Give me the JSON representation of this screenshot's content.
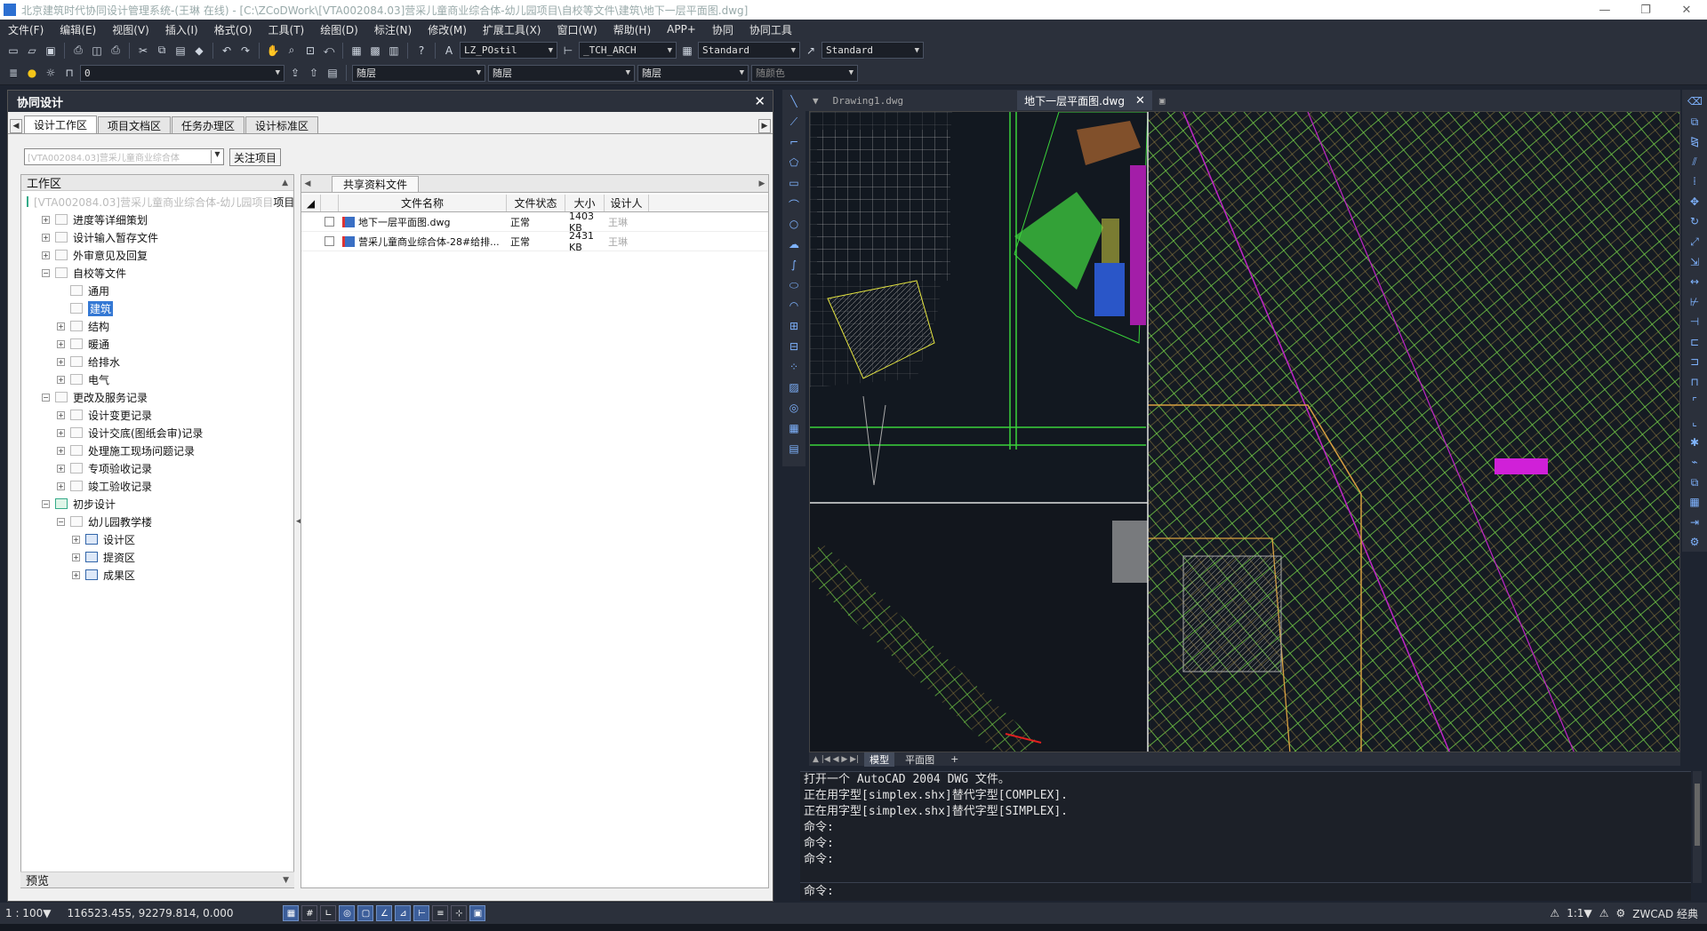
{
  "title_bar": {
    "text": "北京建筑时代协同设计管理系统-(王琳 在线) - [C:\\ZCoDWork\\[VTA002084.03]营采儿童商业综合体-幼儿园项目\\自校等文件\\建筑\\地下一层平面图.dwg]",
    "minimize": "—",
    "maximize": "❐",
    "close": "✕"
  },
  "menu": [
    "文件(F)",
    "编辑(E)",
    "视图(V)",
    "插入(I)",
    "格式(O)",
    "工具(T)",
    "绘图(D)",
    "标注(N)",
    "修改(M)",
    "扩展工具(X)",
    "窗口(W)",
    "帮助(H)",
    "APP+",
    "协同",
    "协同工具"
  ],
  "toolbar1": {
    "text_style": "LZ_POstil",
    "dim_style": "_TCH_ARCH",
    "table_style": "Standard",
    "multileader_style": "Standard"
  },
  "toolbar2": {
    "layer": "0",
    "color": "随层",
    "linetype": "随层",
    "lineweight": "随层",
    "plotstyle": "随颜色"
  },
  "panel": {
    "title": "协同设计",
    "close": "✕",
    "tabs": [
      "设计工作区",
      "项目文档区",
      "任务办理区",
      "设计标准区"
    ],
    "active_tab": 0,
    "project_select": "[VTA002084.03]营采儿童商业综合体",
    "follow_button": "关注项目",
    "workarea_header": "工作区",
    "preview_header": "预览",
    "tree": [
      {
        "level": 0,
        "label": "[VTA002084.03]营采儿童商业综合体-幼儿园项目",
        "suffix": "项目",
        "icon": "project"
      },
      {
        "level": 1,
        "label": "进度等详细策划",
        "exp": "+"
      },
      {
        "level": 1,
        "label": "设计输入暂存文件",
        "exp": "+"
      },
      {
        "level": 1,
        "label": "外审意见及回复",
        "exp": "+"
      },
      {
        "level": 1,
        "label": "自校等文件",
        "exp": "−"
      },
      {
        "level": 2,
        "label": "通用"
      },
      {
        "level": 2,
        "label": "建筑",
        "selected": true
      },
      {
        "level": 2,
        "label": "结构",
        "exp": "+"
      },
      {
        "level": 2,
        "label": "暖通",
        "exp": "+"
      },
      {
        "level": 2,
        "label": "给排水",
        "exp": "+"
      },
      {
        "level": 2,
        "label": "电气",
        "exp": "+"
      },
      {
        "level": 1,
        "label": "更改及服务记录",
        "exp": "−"
      },
      {
        "level": 2,
        "label": "设计变更记录",
        "exp": "+"
      },
      {
        "level": 2,
        "label": "设计交底(图纸会审)记录",
        "exp": "+"
      },
      {
        "level": 2,
        "label": "处理施工现场问题记录",
        "exp": "+"
      },
      {
        "level": 2,
        "label": "专项验收记录",
        "exp": "+"
      },
      {
        "level": 2,
        "label": "竣工验收记录",
        "exp": "+"
      },
      {
        "level": 1,
        "label": "初步设计",
        "exp": "−",
        "icon": "green"
      },
      {
        "level": 2,
        "label": "幼儿园教学楼",
        "exp": "−"
      },
      {
        "level": 3,
        "label": "设计区",
        "exp": "+",
        "icon": "blue"
      },
      {
        "level": 3,
        "label": "提资区",
        "exp": "+",
        "icon": "blue"
      },
      {
        "level": 3,
        "label": "成果区",
        "exp": "+",
        "icon": "blue"
      }
    ],
    "file_tab": "共享资料文件",
    "columns": [
      "文件名称",
      "文件状态",
      "大小",
      "设计人"
    ],
    "files": [
      {
        "name": "地下一层平面图.dwg",
        "status": "正常",
        "size": "1403 KB",
        "designer": "王琳"
      },
      {
        "name": "营采儿童商业综合体-28#给排...",
        "status": "正常",
        "size": "2431 KB",
        "designer": "王琳"
      }
    ]
  },
  "cad": {
    "tabs": [
      {
        "label": "Drawing1.dwg"
      },
      {
        "label": "地下一层平面图.dwg",
        "active": true
      }
    ],
    "layout_tabs": [
      "模型",
      "平面图",
      "+"
    ],
    "active_layout": 0,
    "command_history": [
      "打开一个 AutoCAD 2004 DWG 文件。",
      "正在用字型[simplex.shx]替代字型[COMPLEX].",
      "正在用字型[simplex.shx]替代字型[SIMPLEX].",
      "命令:",
      "命令:",
      "命令:"
    ],
    "command_prompt": "命令:"
  },
  "status": {
    "scale": "1 : 100▼",
    "coords": "116523.455, 92279.814, 0.000",
    "annotation_scale": "1:1▼",
    "workspace": "ZWCAD 经典"
  },
  "colors": {
    "bg_dark": "#1e2430",
    "toolbar": "#2b303b",
    "accent": "#3478d4"
  }
}
